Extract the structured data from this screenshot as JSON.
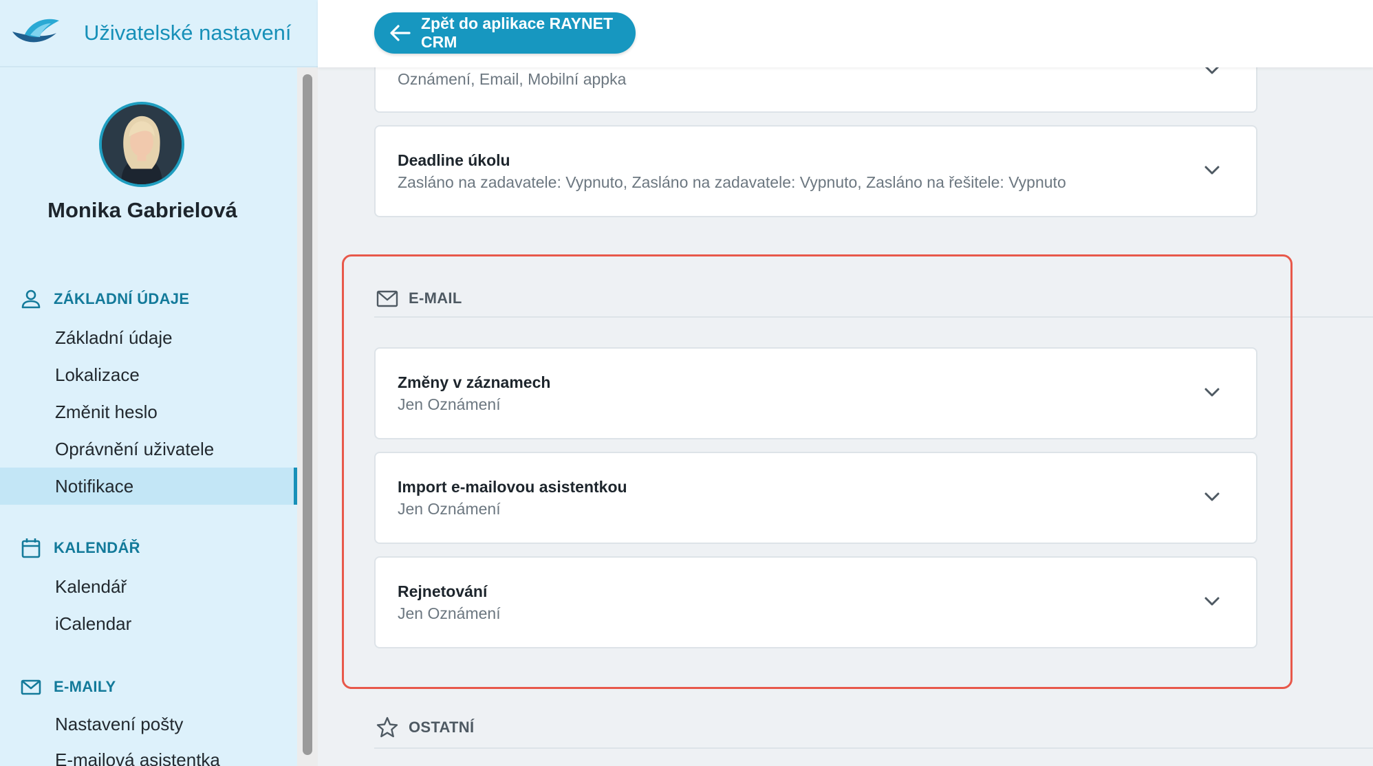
{
  "app": {
    "title": "Uživatelské nastavení"
  },
  "user": {
    "name": "Monika Gabrielová"
  },
  "sidebar": {
    "sections": [
      {
        "label": "ZÁKLADNÍ ÚDAJE",
        "icon": "person-icon",
        "items": [
          "Základní údaje",
          "Lokalizace",
          "Změnit heslo",
          "Oprávnění uživatele",
          "Notifikace"
        ]
      },
      {
        "label": "KALENDÁŘ",
        "icon": "calendar-icon",
        "items": [
          "Kalendář",
          "iCalendar"
        ]
      },
      {
        "label": "E-MAILY",
        "icon": "envelope-icon",
        "items": [
          "Nastavení pošty",
          "E-mailová asistentka"
        ]
      }
    ],
    "active_item": "Notifikace"
  },
  "topbar": {
    "back_label": "Zpět do aplikace RAYNET CRM"
  },
  "cards_top": [
    {
      "title": "",
      "subtitle": "Oznámení, Email, Mobilní appka"
    },
    {
      "title": "Deadline úkolu",
      "subtitle": "Zasláno na zadavatele: Vypnuto, Zasláno na zadavatele: Vypnuto, Zasláno na řešitele: Vypnuto"
    }
  ],
  "groups": [
    {
      "label": "E-MAIL",
      "icon": "envelope-icon",
      "cards": [
        {
          "title": "Změny v záznamech",
          "subtitle": "Jen Oznámení"
        },
        {
          "title": "Import e-mailovou asistentkou",
          "subtitle": "Jen Oznámení"
        },
        {
          "title": "Rejnetování",
          "subtitle": "Jen Oznámení"
        }
      ]
    },
    {
      "label": "OSTATNÍ",
      "icon": "star-icon",
      "cards": []
    }
  ],
  "colors": {
    "accent": "#1797c0",
    "sidebar_bg": "#ddf1fb",
    "highlight": "#e8584a"
  }
}
